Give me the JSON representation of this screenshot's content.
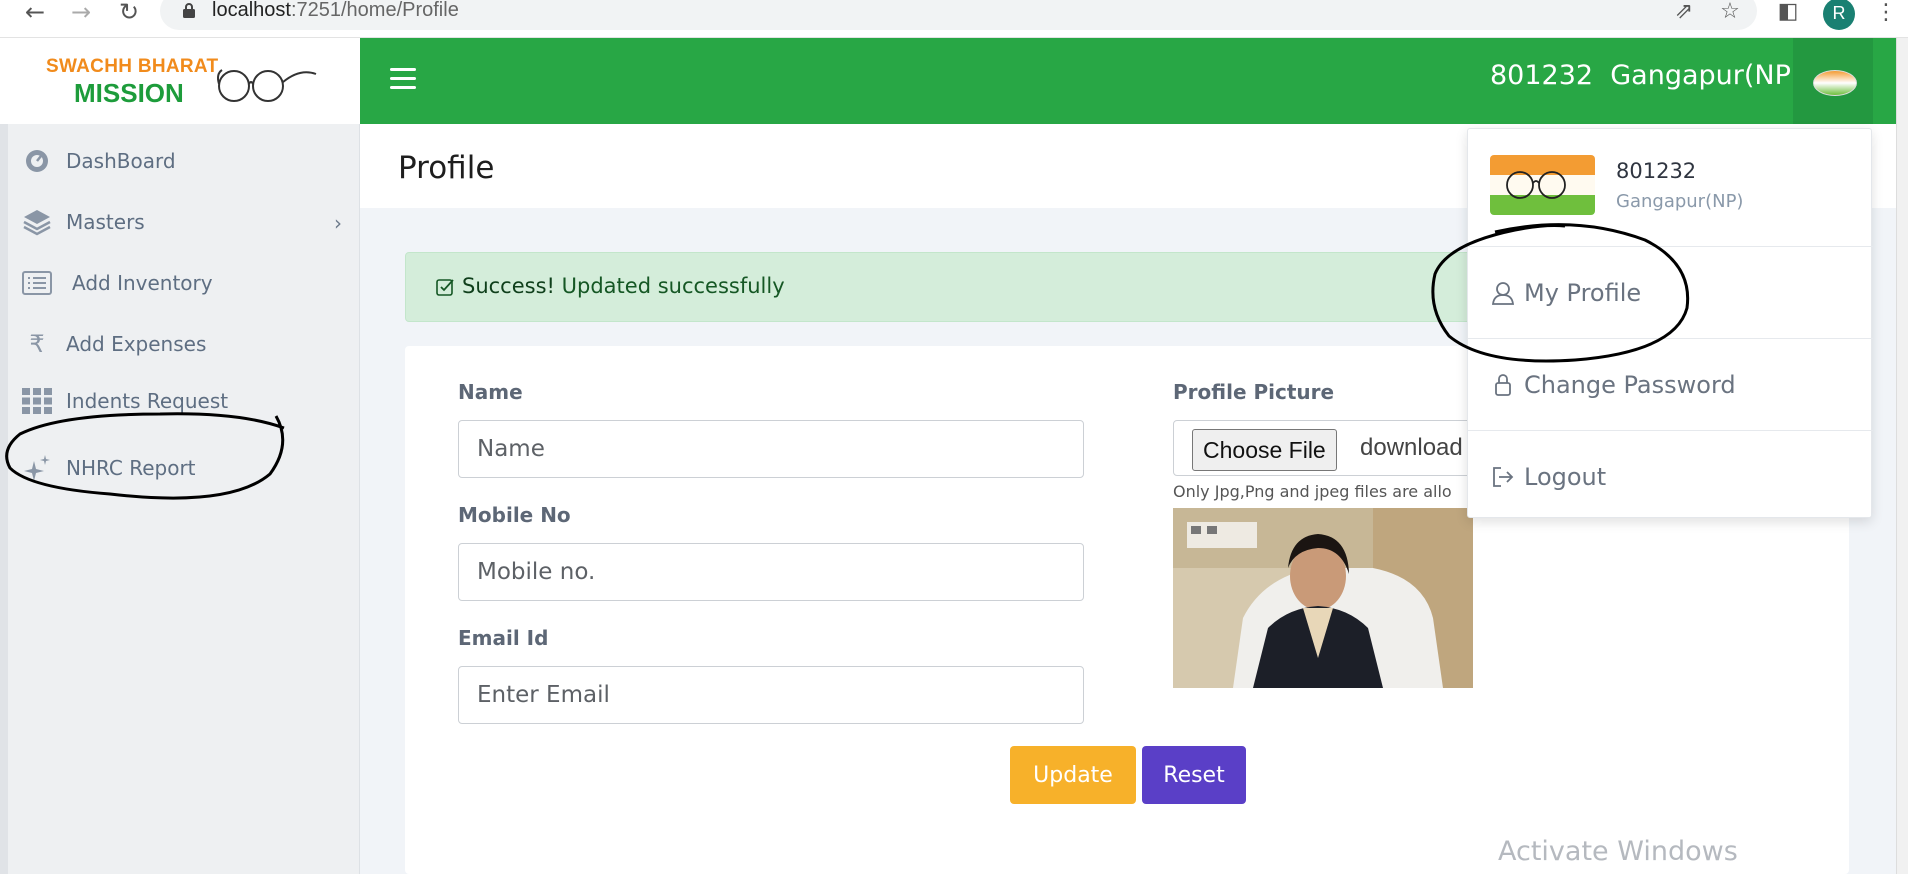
{
  "browser": {
    "url_host": "localhost",
    "url_path": ":7251/home/Profile",
    "profile_initial": "R"
  },
  "sidebar": {
    "logo_line1": "SWACHH BHARAT",
    "logo_line2": "MISSION",
    "items": [
      {
        "label": "DashBoard",
        "icon": "dashboard-icon"
      },
      {
        "label": "Masters",
        "icon": "layers-icon",
        "has_children": true
      },
      {
        "label": "Add Inventory",
        "icon": "list-icon"
      },
      {
        "label": "Add Expenses",
        "icon": "rupee-icon"
      },
      {
        "label": "Indents Request",
        "icon": "grid-icon"
      },
      {
        "label": "NHRC Report",
        "icon": "sparkle-icon"
      }
    ]
  },
  "header": {
    "user_code": "801232",
    "user_place": "Gangapur(NP)",
    "brand_color": "#28a745"
  },
  "page": {
    "title": "Profile"
  },
  "alert": {
    "strong": "Success!",
    "message": "Updated successfully"
  },
  "form": {
    "name_label": "Name",
    "name_placeholder": "Name",
    "mobile_label": "Mobile No",
    "mobile_placeholder": "Mobile no.",
    "email_label": "Email Id",
    "email_placeholder": "Enter Email",
    "picture_label": "Profile Picture",
    "choose_file_label": "Choose File",
    "file_name": "download",
    "file_note": "Only Jpg,Png and jpeg files are allo",
    "update_label": "Update",
    "reset_label": "Reset",
    "update_color": "#f7b12a",
    "reset_color": "#5a3fc7"
  },
  "dropdown": {
    "code": "801232",
    "place": "Gangapur(NP)",
    "items": [
      {
        "label": "My Profile",
        "icon": "user-icon"
      },
      {
        "label": "Change Password",
        "icon": "lock-icon"
      },
      {
        "label": "Logout",
        "icon": "logout-icon"
      }
    ]
  },
  "watermark": "Activate Windows"
}
